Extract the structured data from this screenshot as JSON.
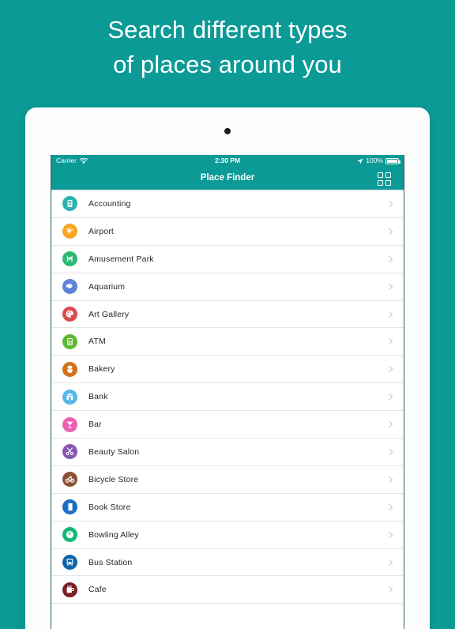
{
  "theme": {
    "brand_teal": "#0b9a96",
    "screen_bg": "#f4f5f6",
    "list_bg": "#ffffff",
    "text": "#26272b"
  },
  "headline": {
    "line1": "Search different types",
    "line2": "of places around you"
  },
  "device": {
    "camera": "camera-dot"
  },
  "status_bar": {
    "carrier": "Carrier",
    "wifi_icon": "wifi-icon",
    "time": "2:30 PM",
    "location_icon": "location-arrow-icon",
    "battery_percent": "100%",
    "battery_icon": "battery-full-icon"
  },
  "nav_bar": {
    "title": "Place Finder",
    "grid_button_icon": "grid-view-icon"
  },
  "list": {
    "disclosure_icon": "chevron-right-icon",
    "items": [
      {
        "label": "Accounting",
        "icon": "document-icon",
        "color": "#2bb3b0"
      },
      {
        "label": "Airport",
        "icon": "airplane-icon",
        "color": "#f5a623"
      },
      {
        "label": "Amusement Park",
        "icon": "carousel-horse-icon",
        "color": "#2eb872"
      },
      {
        "label": "Aquarium",
        "icon": "fish-icon",
        "color": "#5b82d6"
      },
      {
        "label": "Art Gallery",
        "icon": "palette-icon",
        "color": "#d94a4f"
      },
      {
        "label": "ATM",
        "icon": "atm-machine-icon",
        "color": "#5cb82e"
      },
      {
        "label": "Bakery",
        "icon": "cupcake-icon",
        "color": "#d1721a"
      },
      {
        "label": "Bank",
        "icon": "bank-building-icon",
        "color": "#57b7e8"
      },
      {
        "label": "Bar",
        "icon": "cocktail-glass-icon",
        "color": "#ec5fb0"
      },
      {
        "label": "Beauty Salon",
        "icon": "scissors-icon",
        "color": "#8457b5"
      },
      {
        "label": "Bicycle Store",
        "icon": "bicycle-icon",
        "color": "#8a5233"
      },
      {
        "label": "Book Store",
        "icon": "book-icon",
        "color": "#1c6dc4"
      },
      {
        "label": "Bowling Alley",
        "icon": "bowling-ball-icon",
        "color": "#13b878"
      },
      {
        "label": "Bus Station",
        "icon": "bus-icon",
        "color": "#0d63ab"
      },
      {
        "label": "Cafe",
        "icon": "coffee-cup-icon",
        "color": "#7a1f24"
      }
    ]
  }
}
